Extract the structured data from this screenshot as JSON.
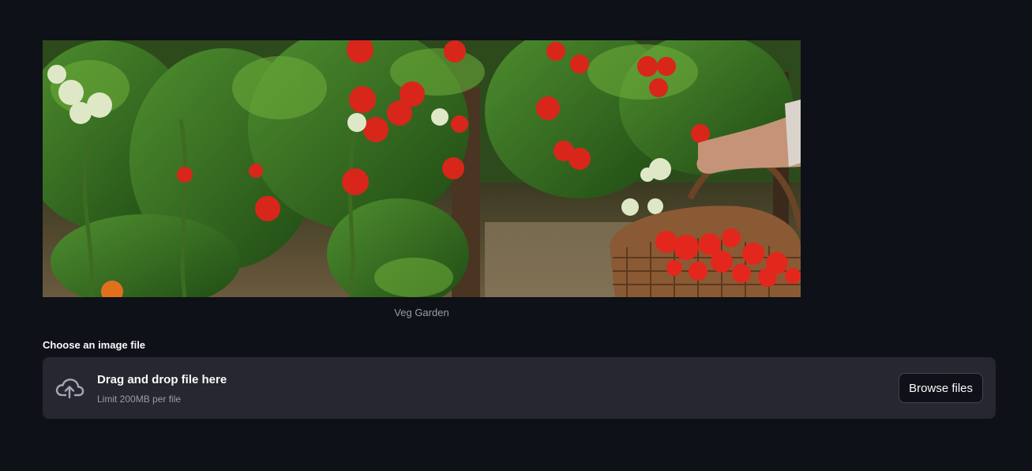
{
  "image": {
    "caption": "Veg Garden"
  },
  "uploader": {
    "label": "Choose an image file",
    "drop_title": "Drag and drop file here",
    "limit_text": "Limit 200MB per file",
    "browse_label": "Browse files",
    "icon": "cloud-upload-icon"
  },
  "colors": {
    "background": "#0e1117",
    "dropzone": "#262730",
    "muted_text": "#9a9ca6",
    "button_border": "#41444e"
  }
}
